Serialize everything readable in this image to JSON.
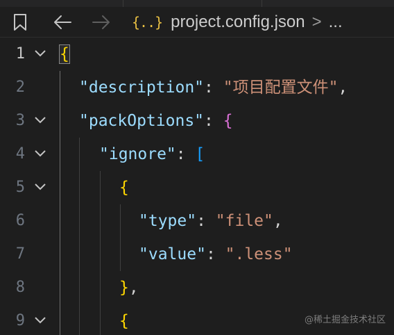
{
  "breadcrumb": {
    "file_icon": "{..}",
    "file_icon_name": "json-braces-icon",
    "filename": "project.config.json",
    "separator": ">",
    "ellipsis": "..."
  },
  "icons": {
    "bookmark": "bookmark-icon",
    "back": "arrow-left-icon",
    "forward": "arrow-right-icon",
    "fold": "chevron-down-icon"
  },
  "colors": {
    "background": "#1e1e1e",
    "key": "#9cdcfe",
    "string": "#ce9178",
    "bracket_level1": "#ffd700",
    "bracket_level2": "#da70d6",
    "bracket_level3": "#179fff",
    "line_number": "#6e7681"
  },
  "lines": [
    {
      "number": "1",
      "foldable": true
    },
    {
      "number": "2",
      "foldable": false,
      "key": "\"description\"",
      "colon": ": ",
      "value": "\"项目配置文件\"",
      "after": ","
    },
    {
      "number": "3",
      "foldable": true,
      "key": "\"packOptions\"",
      "colon": ": ",
      "bracket": "{"
    },
    {
      "number": "4",
      "foldable": true,
      "key": "\"ignore\"",
      "colon": ": ",
      "bracket": "["
    },
    {
      "number": "5",
      "foldable": true,
      "bracket": "{"
    },
    {
      "number": "6",
      "foldable": false,
      "key": "\"type\"",
      "colon": ": ",
      "value": "\"file\"",
      "after": ","
    },
    {
      "number": "7",
      "foldable": false,
      "key": "\"value\"",
      "colon": ": ",
      "value": "\".less\""
    },
    {
      "number": "8",
      "foldable": false,
      "bracket": "}",
      "after": ","
    },
    {
      "number": "9",
      "foldable": true,
      "bracket": "{"
    }
  ],
  "root_bracket": "{",
  "watermark": "@稀土掘金技术社区"
}
